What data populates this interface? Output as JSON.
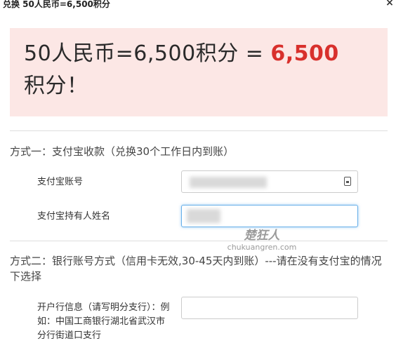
{
  "dialog": {
    "title": "兑换 50人民币=6,500积分",
    "close_label": "×"
  },
  "banner": {
    "prefix": "50人民币=6,500积分 = ",
    "amount": "6,500",
    "suffix": "积分！"
  },
  "method1": {
    "title": "方式一：支付宝收款（兑换30个工作日内到账）",
    "account_label": "支付宝账号",
    "account_value": "",
    "holder_label": "支付宝持有人姓名",
    "holder_value": ""
  },
  "method2": {
    "title": "方式二：银行账号方式（信用卡无效,30-45天内到账）---请在没有支付宝的情况下选择",
    "bank_label": "开户行信息（请写明分支行）：例如：中国工商银行湖北省武汉市分行街道口支行",
    "bank_value": ""
  },
  "watermark": {
    "cn": "楚狂人",
    "en": "chukuangren.com"
  },
  "colors": {
    "accent_red": "#d8302c",
    "banner_bg": "#fce7e5",
    "focus_blue": "#66afe9"
  }
}
